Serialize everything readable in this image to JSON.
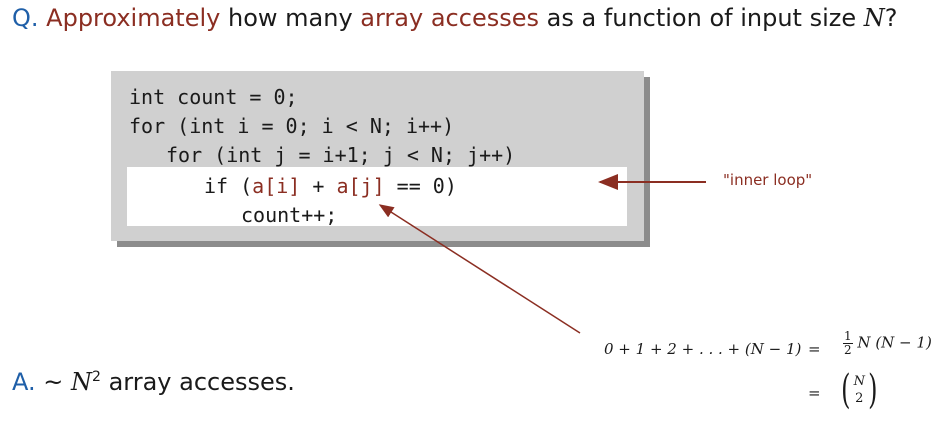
{
  "question": {
    "prefix": "Q.",
    "word_approximately": "Approximately",
    "text_how_many": " how many ",
    "word_array_accesses": "array accesses",
    "text_rest": " as a function of input size ",
    "var_n": "N",
    "qmark": "?"
  },
  "code": {
    "line1": "int count = 0;",
    "line2": "for (int i = 0; i < N; i++)",
    "line3": "for (int j = i+1; j < N; j++)",
    "line4_pre": "if (",
    "line4_a": "a[i]",
    "line4_mid": " + ",
    "line4_b": "a[j]",
    "line4_post": " == 0)",
    "line5": "count++;"
  },
  "annotation": {
    "inner_loop_label": "\"inner loop\""
  },
  "formula": {
    "lhs": "0 + 1 + 2 + . . . + (N − 1)",
    "eq": "=",
    "frac_num": "1",
    "frac_den": "2",
    "rhs1": "N (N − 1)",
    "binom_top": "N",
    "binom_bottom": "2"
  },
  "answer": {
    "prefix": "A.",
    "tilde": "~",
    "var": "N",
    "exp": "2",
    "text": " array accesses."
  },
  "colors": {
    "accent": "#8b2e22",
    "label_blue": "#1f5fa8",
    "code_bg": "#d0d0d0",
    "code_shadow": "#8c8c8c"
  }
}
